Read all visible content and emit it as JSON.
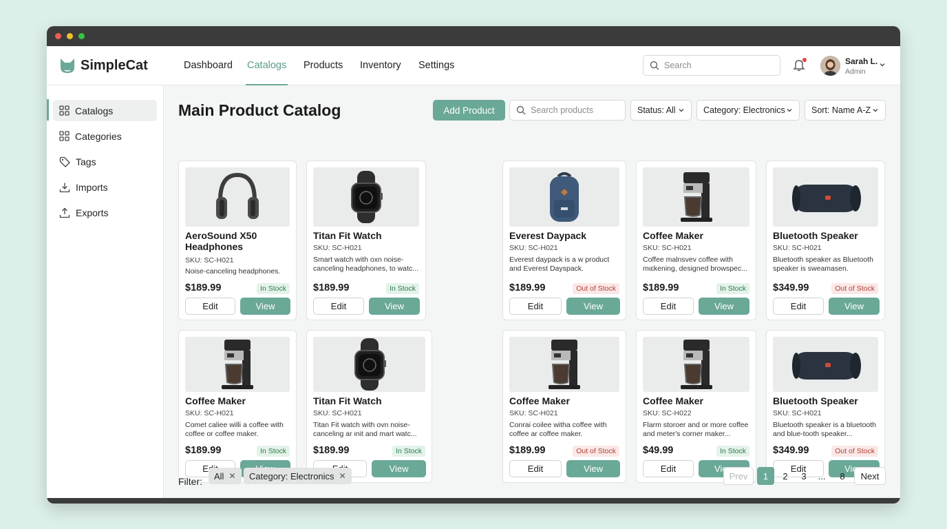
{
  "app": {
    "name": "SimpleCat"
  },
  "nav": {
    "tabs": [
      {
        "label": "Dashboard"
      },
      {
        "label": "Catalogs",
        "active": true
      },
      {
        "label": "Products"
      },
      {
        "label": "Inventory"
      },
      {
        "label": "Settings"
      }
    ],
    "search_placeholder": "Search"
  },
  "user": {
    "name": "Sarah L.",
    "role": "Admin"
  },
  "sidebar": {
    "items": [
      {
        "label": "Catalogs",
        "icon": "grid-icon",
        "active": true
      },
      {
        "label": "Categories",
        "icon": "grid-icon"
      },
      {
        "label": "Tags",
        "icon": "tag-icon"
      },
      {
        "label": "Imports",
        "icon": "download-icon"
      },
      {
        "label": "Exports",
        "icon": "upload-icon"
      }
    ]
  },
  "main": {
    "title": "Main Product Catalog",
    "add_label": "Add Product",
    "search_placeholder": "Search products",
    "status_filter": "Status: All",
    "category_filter": "Category: Electronics",
    "sort": "Sort: Name A-Z"
  },
  "products": [
    {
      "name": "AeroSound X50 Headphones",
      "sku": "SKU: SC-H021",
      "desc": "Noise-canceling headphones.",
      "price": "$189.99",
      "status": "In Stock",
      "image": "headphones"
    },
    {
      "name": "Titan Fit Watch",
      "sku": "SKU: SC-H021",
      "desc": "Smart watch with oxn noise-canceling headphones, to watc...",
      "price": "$189.99",
      "status": "In Stock",
      "image": "watch"
    },
    {
      "name": "Everest Daypack",
      "sku": "SKU: SC-H021",
      "desc": "Everest daypack is a w product and Everest Dayspack.",
      "price": "$189.99",
      "status": "Out of Stock",
      "image": "backpack"
    },
    {
      "name": "Coffee Maker",
      "sku": "SKU: SC-H021",
      "desc": "Coffee malnsvev coffee with mιɛkening, designed browspec...",
      "price": "$189.99",
      "status": "In Stock",
      "image": "coffee"
    },
    {
      "name": "Bluetooth Speaker",
      "sku": "SKU: SC-H021",
      "desc": "Bluetooth speaker as Bluetooth speaker is sweamasen.",
      "price": "$349.99",
      "status": "Out of Stock",
      "image": "speaker"
    },
    {
      "name": "Coffee Maker",
      "sku": "SKU: SC-H021",
      "desc": "Comet caliee willi a coffee with coffee or coffee maker.",
      "price": "$189.99",
      "status": "In Stock",
      "image": "coffee"
    },
    {
      "name": "Titan Fit Watch",
      "sku": "SKU: SC-H021",
      "desc": "Titan Fit watch with ovrι noise-canceling ar ιnit and mart watc...",
      "price": "$189.99",
      "status": "In Stock",
      "image": "watch"
    },
    {
      "name": "Coffee Maker",
      "sku": "SKU: SC-H021",
      "desc": "Conrai coilee witha coffee with coffee ar coffee maker.",
      "price": "$189.99",
      "status": "Out of Stock",
      "image": "coffee"
    },
    {
      "name": "Coffee Maker",
      "sku": "SKU: SC-H022",
      "desc": "Flarm storoer and or more coffee and meter's corner maker...",
      "price": "$49.99",
      "status": "In Stock",
      "image": "coffee"
    },
    {
      "name": "Bluetooth Speaker",
      "sku": "SKU: SC-H021",
      "desc": "Bluetooth speaker is a bluetooth and blue-tooth speaker...",
      "price": "$349.99",
      "status": "Out of Stock",
      "image": "speaker"
    }
  ],
  "labels": {
    "edit": "Edit",
    "view": "View"
  },
  "filter": {
    "label": "Filter:",
    "chips": [
      {
        "label": "All"
      },
      {
        "label": "Category: Electronics"
      }
    ]
  },
  "pagination": {
    "prev": "Prev",
    "pages": [
      "1",
      "2",
      "3",
      "...",
      "8"
    ],
    "current": "1",
    "next": "Next"
  },
  "colors": {
    "accent": "#6aa898",
    "in_stock_bg": "#e4f3ea",
    "out_stock_bg": "#fbe8e6"
  }
}
